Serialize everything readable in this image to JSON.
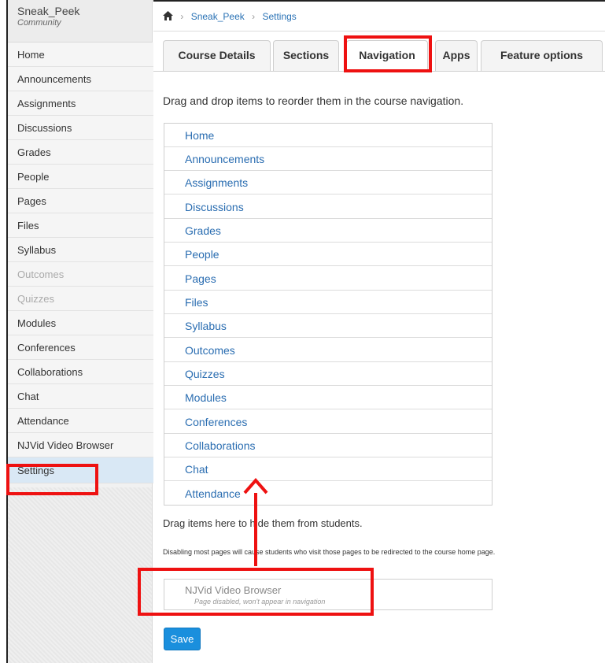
{
  "course": {
    "name": "Sneak_Peek",
    "subtitle": "Community"
  },
  "sidebar": {
    "items": [
      {
        "label": "Home"
      },
      {
        "label": "Announcements"
      },
      {
        "label": "Assignments"
      },
      {
        "label": "Discussions"
      },
      {
        "label": "Grades"
      },
      {
        "label": "People"
      },
      {
        "label": "Pages"
      },
      {
        "label": "Files"
      },
      {
        "label": "Syllabus"
      },
      {
        "label": "Outcomes"
      },
      {
        "label": "Quizzes"
      },
      {
        "label": "Modules"
      },
      {
        "label": "Conferences"
      },
      {
        "label": "Collaborations"
      },
      {
        "label": "Chat"
      },
      {
        "label": "Attendance"
      },
      {
        "label": "NJVid Video Browser"
      },
      {
        "label": "Settings"
      }
    ]
  },
  "breadcrumb": {
    "course": "Sneak_Peek",
    "page": "Settings"
  },
  "tabs": [
    {
      "label": "Course Details"
    },
    {
      "label": "Sections"
    },
    {
      "label": "Navigation"
    },
    {
      "label": "Apps"
    },
    {
      "label": "Feature options"
    }
  ],
  "navigation": {
    "instructions": "Drag and drop items to reorder them in the course navigation.",
    "items": [
      {
        "label": "Home"
      },
      {
        "label": "Announcements"
      },
      {
        "label": "Assignments"
      },
      {
        "label": "Discussions"
      },
      {
        "label": "Grades"
      },
      {
        "label": "People"
      },
      {
        "label": "Pages"
      },
      {
        "label": "Files"
      },
      {
        "label": "Syllabus"
      },
      {
        "label": "Outcomes"
      },
      {
        "label": "Quizzes"
      },
      {
        "label": "Modules"
      },
      {
        "label": "Conferences"
      },
      {
        "label": "Collaborations"
      },
      {
        "label": "Chat"
      },
      {
        "label": "Attendance"
      }
    ],
    "hide_title": "Drag items here to hide them from students.",
    "hide_note": "Disabling most pages will cause students who visit those pages to be redirected to the course home page.",
    "hidden_items": [
      {
        "label": "NJVid Video Browser",
        "sub": "Page disabled, won't appear in navigation"
      }
    ],
    "save_label": "Save"
  },
  "colors": {
    "link": "#2a6db1",
    "highlight": "#ee1111",
    "button": "#1a8fdd"
  }
}
